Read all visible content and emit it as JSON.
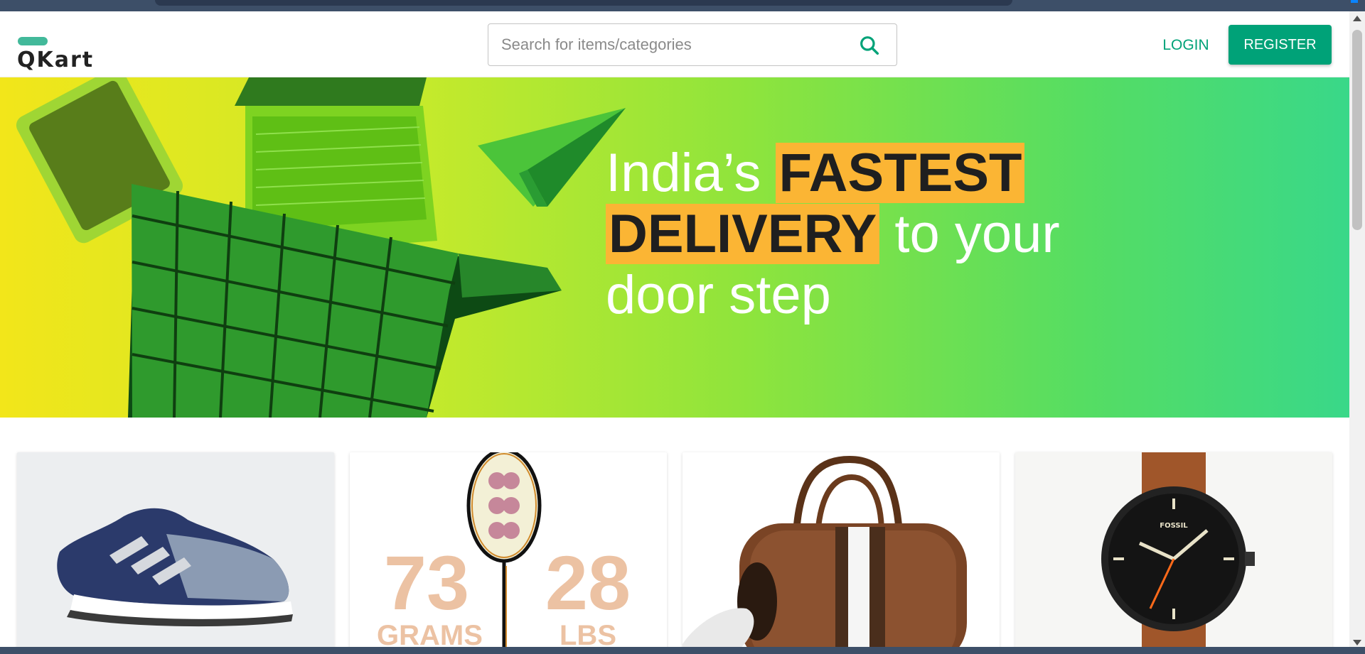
{
  "brand": {
    "name": "QKart",
    "accent_color": "#00a278",
    "logo_bar_color": "#42b99a"
  },
  "search": {
    "placeholder": "Search for items/categories",
    "value": "",
    "icon": "search-icon"
  },
  "auth": {
    "login_label": "LOGIN",
    "register_label": "REGISTER"
  },
  "hero": {
    "line_part1": "India’s ",
    "highlight1": "FASTEST",
    "highlight2": "DELIVERY",
    "line_part2": " to your door step",
    "highlight_color": "#fbb534"
  },
  "products": [
    {
      "image": "sneaker"
    },
    {
      "image": "badminton-racket",
      "stat1_value": "73",
      "stat1_unit": "GRAMS",
      "stat2_value": "28",
      "stat2_unit": "LBS"
    },
    {
      "image": "leather-duffel-bag"
    },
    {
      "image": "wrist-watch",
      "watch_brand": "FOSSIL"
    }
  ]
}
